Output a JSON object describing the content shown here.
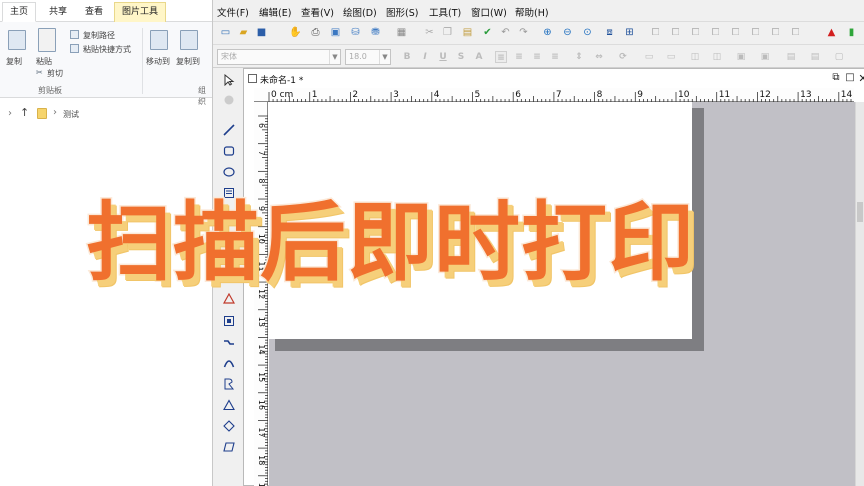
{
  "explorer": {
    "tabs": [
      "主页",
      "共享",
      "查看",
      "图片工具"
    ],
    "ribbon": {
      "copy": "复制",
      "paste": "粘贴",
      "copy_path": "复制路径",
      "paste_shortcut": "粘贴快捷方式",
      "cut": "剪切",
      "clipboard_group": "剪贴板",
      "move_to": "移动到",
      "copy_to": "复制到",
      "organize_group": "组织"
    },
    "nav_path": "测试"
  },
  "app": {
    "menu": [
      "文件(F)",
      "编辑(E)",
      "查看(V)",
      "绘图(D)",
      "图形(S)",
      "工具(T)",
      "窗口(W)",
      "帮助(H)"
    ],
    "toolbar_icons": [
      "new-icon",
      "open-icon",
      "save-icon",
      "hand-icon",
      "print-icon",
      "print-preview-icon",
      "database-icon",
      "database-settings-icon",
      "grid-icon",
      "cut-icon",
      "copy-icon",
      "paste-icon",
      "check-icon",
      "undo-icon",
      "redo-icon",
      "zoom-in-icon",
      "zoom-out-icon",
      "zoom-fit-icon",
      "snap-icon",
      "grid-toggle-icon",
      "pdf-icon",
      "battery-icon"
    ],
    "font_combo": "宋体",
    "font_size": "18.0",
    "doc": {
      "title": "未命名-1 *",
      "ruler_unit": "cm",
      "h_ruler_labels": [
        "0",
        "1",
        "2",
        "3",
        "4",
        "5",
        "6",
        "7",
        "8",
        "9",
        "10",
        "11",
        "12",
        "13",
        "14"
      ],
      "v_ruler_labels": [
        "6",
        "7",
        "8",
        "9",
        "10",
        "11",
        "12",
        "13",
        "14",
        "15",
        "16",
        "17",
        "18",
        "19"
      ]
    }
  },
  "caption": {
    "text": "扫描后即时打印",
    "color": "#f0702e",
    "shadow_color": "#f6cf7a"
  }
}
